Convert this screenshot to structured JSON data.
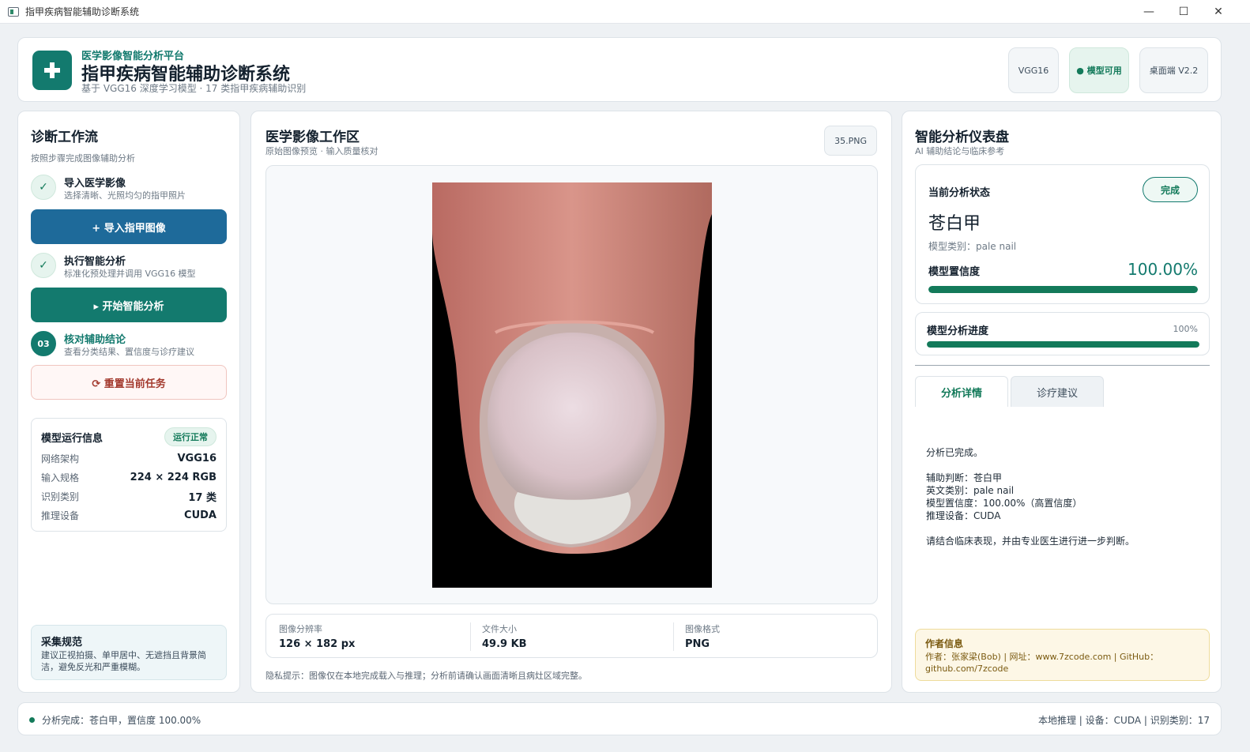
{
  "window": {
    "title": "指甲疾病智能辅助诊断系统",
    "minimize": "—",
    "maximize": "☐",
    "close": "✕"
  },
  "header": {
    "subtitle": "医学影像智能分析平台",
    "title": "指甲疾病智能辅助诊断系统",
    "description": "基于 VGG16 深度学习模型 · 17 类指甲疾病辅助识别",
    "chips": {
      "model": "VGG16",
      "status": "● 模型可用",
      "version": "桌面端 V2.2"
    }
  },
  "workflow": {
    "title": "诊断工作流",
    "subtitle": "按照步骤完成图像辅助分析",
    "steps": [
      {
        "marker": "✓",
        "title": "导入医学影像",
        "desc": "选择清晰、光照均匀的指甲照片"
      },
      {
        "marker": "✓",
        "title": "执行智能分析",
        "desc": "标准化预处理并调用 VGG16 模型"
      },
      {
        "marker": "03",
        "title": "核对辅助结论",
        "desc": "查看分类结果、置信度与诊疗建议"
      }
    ],
    "buttons": {
      "import": "+ 导入指甲图像",
      "analyze": "▸ 开始智能分析",
      "reset": "⟳ 重置当前任务"
    }
  },
  "model_info": {
    "title": "模型运行信息",
    "badge": "运行正常",
    "rows": [
      {
        "k": "网络架构",
        "v": "VGG16"
      },
      {
        "k": "输入规格",
        "v": "224 × 224 RGB"
      },
      {
        "k": "识别类别",
        "v": "17 类"
      },
      {
        "k": "推理设备",
        "v": "CUDA"
      }
    ]
  },
  "spec": {
    "title": "采集规范",
    "text": "建议正视拍摄、单甲居中、无遮挡且背景简洁，避免反光和严重模糊。"
  },
  "workspace": {
    "title": "医学影像工作区",
    "subtitle": "原始图像预览 · 输入质量核对",
    "filename": "35.PNG",
    "meta": [
      {
        "label": "图像分辨率",
        "value": "126 × 182 px"
      },
      {
        "label": "文件大小",
        "value": "49.9 KB"
      },
      {
        "label": "图像格式",
        "value": "PNG"
      }
    ],
    "privacy": "隐私提示：图像仅在本地完成载入与推理；分析前请确认画面清晰且病灶区域完整。"
  },
  "dashboard": {
    "title": "智能分析仪表盘",
    "subtitle": "AI 辅助结论与临床参考",
    "status_label": "当前分析状态",
    "status": "完成",
    "diagnosis": "苍白甲",
    "category": "模型类别：pale nail",
    "confidence_label": "模型置信度",
    "confidence_text": "100.00%",
    "confidence": 1.0,
    "progress_label": "模型分析进度",
    "progress_text": "100%",
    "progress": 1.0,
    "tabs": [
      "分析详情",
      "诊疗建议"
    ],
    "details": {
      "line1": "分析已完成。",
      "line2": "辅助判断：苍白甲",
      "line3": "英文类别：pale nail",
      "line4": "模型置信度：100.00%（高置信度）",
      "line5": "推理设备：CUDA",
      "line6": "请结合临床表现，并由专业医生进行进一步判断。"
    },
    "author_title": "作者信息",
    "author_text": "作者：张家梁(Bob) | 网址：www.7zcode.com | GitHub：github.com/7zcode"
  },
  "footer": {
    "status": "分析完成：苍白甲，置信度 100.00%",
    "right": "本地推理 | 设备：CUDA | 识别类别：17"
  }
}
